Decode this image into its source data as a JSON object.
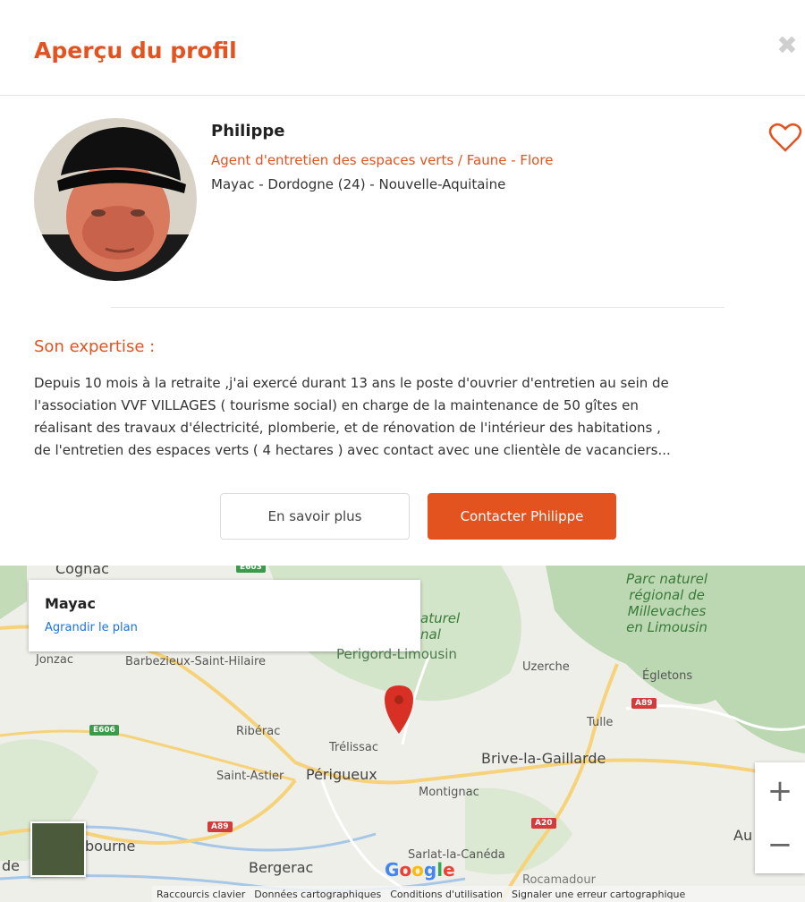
{
  "header": {
    "title": "Aperçu du profil",
    "close_icon": "close-icon"
  },
  "profile": {
    "name": "Philippe",
    "job": "Agent d'entretien des espaces verts / Faune - Flore",
    "location": "Mayac - Dordogne (24) - Nouvelle-Aquitaine",
    "favorite_icon": "heart-icon"
  },
  "expertise": {
    "title": "Son expertise :",
    "text": "Depuis 10 mois à la retraite ,j'ai exercé durant 13 ans le poste d'ouvrier d'entretien au sein de\nl'association VVF VILLAGES ( tourisme social) en charge de la maintenance de 50 gîtes en\nréalisant des travaux d'électricité, plomberie, et de rénovation de l'intérieur des habitations ,\nde l'entretien des espaces verts ( 4 hectares ) avec contact avec une clientèle de vacanciers..."
  },
  "actions": {
    "more_label": "En savoir plus",
    "contact_label": "Contacter Philippe"
  },
  "map": {
    "place_name": "Mayac",
    "enlarge_label": "Agrandir le plan",
    "labels": {
      "cognac": "Cognac",
      "jonzac": "Jonzac",
      "barbezieux": "Barbezieux-Saint-Hilaire",
      "riberac": "Ribérac",
      "trelissac": "Trélissac",
      "saint_astier": "Saint-Astier",
      "perigueux": "Périgueux",
      "montignac": "Montignac",
      "sarlat": "Sarlat-la-Canéda",
      "bergerac": "Bergerac",
      "libourne": "bourne",
      "de": "de",
      "uzerche": "Uzerche",
      "egletons": "Égletons",
      "tulle": "Tulle",
      "brive": "Brive-la-Gaillarde",
      "aurillac": "Au",
      "rocamadour": "Rocamadour",
      "park_perigord_1": "aturel",
      "park_perigord_2": "nal",
      "park_perigord_3": "Perigord-Limousin",
      "park_millevaches": "Parc naturel\nrégional de\nMillevaches\nen Limousin"
    },
    "roads": {
      "e606": "E606",
      "a89_west": "A89",
      "a89_east": "A89",
      "a20": "A20",
      "e603": "E603"
    },
    "zoom_in": "+",
    "zoom_out": "−",
    "google_logo": "Google",
    "attribution": [
      "Raccourcis clavier",
      "Données cartographiques",
      "Conditions d'utilisation",
      "Signaler une erreur cartographique"
    ]
  },
  "colors": {
    "accent": "#e25320",
    "link": "#1a73e8",
    "pin": "#d93025"
  }
}
